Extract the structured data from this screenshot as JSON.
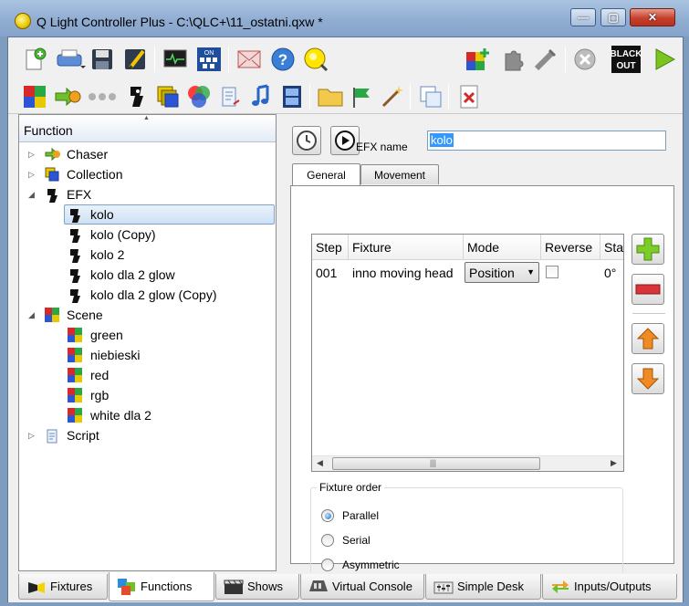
{
  "window": {
    "title": "Q Light Controller Plus - C:\\QLC+\\11_ostatni.qxw *",
    "minimize_glyph": "—",
    "maximize_glyph": "▢",
    "close_glyph": "✕"
  },
  "toolbar": {
    "blackout_line1": "BLACK",
    "blackout_line2": "OUT",
    "dmx_label": "ON"
  },
  "function_tree": {
    "header": "Function",
    "items": [
      {
        "label": "Chaser",
        "icon": "chaser-icon",
        "expanded": false
      },
      {
        "label": "Collection",
        "icon": "collection-icon",
        "expanded": false
      },
      {
        "label": "EFX",
        "icon": "efx-icon",
        "expanded": true
      },
      {
        "label": "kolo",
        "icon": "efx-icon",
        "selected": true
      },
      {
        "label": "kolo (Copy)",
        "icon": "efx-icon"
      },
      {
        "label": "kolo 2",
        "icon": "efx-icon"
      },
      {
        "label": "kolo dla 2 glow",
        "icon": "efx-icon"
      },
      {
        "label": "kolo dla 2 glow (Copy)",
        "icon": "efx-icon"
      },
      {
        "label": "Scene",
        "icon": "scene-icon",
        "expanded": true
      },
      {
        "label": "green",
        "icon": "scene-icon"
      },
      {
        "label": "niebieski",
        "icon": "scene-icon"
      },
      {
        "label": "red",
        "icon": "scene-icon"
      },
      {
        "label": "rgb",
        "icon": "scene-icon"
      },
      {
        "label": "white dla 2",
        "icon": "scene-icon"
      },
      {
        "label": "Script",
        "icon": "script-icon",
        "expanded": false
      }
    ]
  },
  "editor": {
    "efx_name_label": "EFX name",
    "efx_name_value": "kolo",
    "tabs": [
      {
        "label": "General",
        "active": true
      },
      {
        "label": "Movement",
        "active": false
      }
    ],
    "fixtures_table": {
      "columns": [
        "Step",
        "Fixture",
        "Mode",
        "Reverse",
        "Sta"
      ],
      "rows": [
        {
          "step": "001",
          "fixture": "inno moving head",
          "mode": "Position",
          "reverse": false,
          "start": "0°"
        }
      ]
    },
    "fixture_order": {
      "title": "Fixture order",
      "options": [
        {
          "label": "Parallel",
          "selected": true
        },
        {
          "label": "Serial",
          "selected": false
        },
        {
          "label": "Asymmetric",
          "selected": false
        }
      ]
    }
  },
  "bottom_tabs": [
    {
      "label": "Fixtures",
      "active": false
    },
    {
      "label": "Functions",
      "active": true
    },
    {
      "label": "Shows",
      "active": false
    },
    {
      "label": "Virtual Console",
      "active": false
    },
    {
      "label": "Simple Desk",
      "active": false
    },
    {
      "label": "Inputs/Outputs",
      "active": false
    }
  ],
  "colors": {
    "titlebar": "#8eabd0",
    "selection": "#cfe0f4",
    "text_highlight": "#3399ff",
    "add_green": "#6fbf2a",
    "remove_red": "#d8343a",
    "move_orange": "#f08a24"
  }
}
